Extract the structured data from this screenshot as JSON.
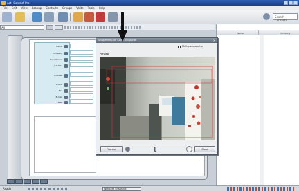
{
  "window": {
    "title": "Act! Contact Pro"
  },
  "menu": [
    "File",
    "Edit",
    "View",
    "Lookup",
    "Contacts",
    "Groups",
    "Write",
    "Tools",
    "Help"
  ],
  "search": {
    "value": "Search Contacts"
  },
  "address_select": {
    "value": "All"
  },
  "contact_fields": [
    {
      "label": "Name",
      "icon": "person-icon"
    },
    {
      "label": "Company",
      "icon": "building-icon"
    },
    {
      "label": "Department",
      "icon": "group-icon"
    },
    {
      "label": "Job Title",
      "icon": "star-icon"
    },
    {
      "label": "Address",
      "icon": "home-icon"
    },
    {
      "label": "Phone",
      "icon": "phone-icon"
    },
    {
      "label": "Fax",
      "icon": "fax-icon"
    },
    {
      "label": "E-mail",
      "icon": "mail-icon"
    },
    {
      "label": "Web",
      "icon": "globe-icon"
    }
  ],
  "right_panel": {
    "col1": "Name",
    "col2": "Company"
  },
  "statusbar": {
    "left": "Ready",
    "task": "Webcam Snapshot"
  },
  "dialog": {
    "title": "Snap from Live Cam - Snapshot",
    "close_glyph": "×",
    "multiple_snapshot_label": "Multiple snapshot",
    "multiple_snapshot_checked": false,
    "preview_label": "Preview",
    "process_button": "Process",
    "close_button": "Close",
    "brightness_level": 0.44
  },
  "colors": {
    "title_bar": "#2d5fb4",
    "detection_box": "#c8322d",
    "field_panel": "#d6ebf2",
    "annotation_arrow": "#111111"
  }
}
